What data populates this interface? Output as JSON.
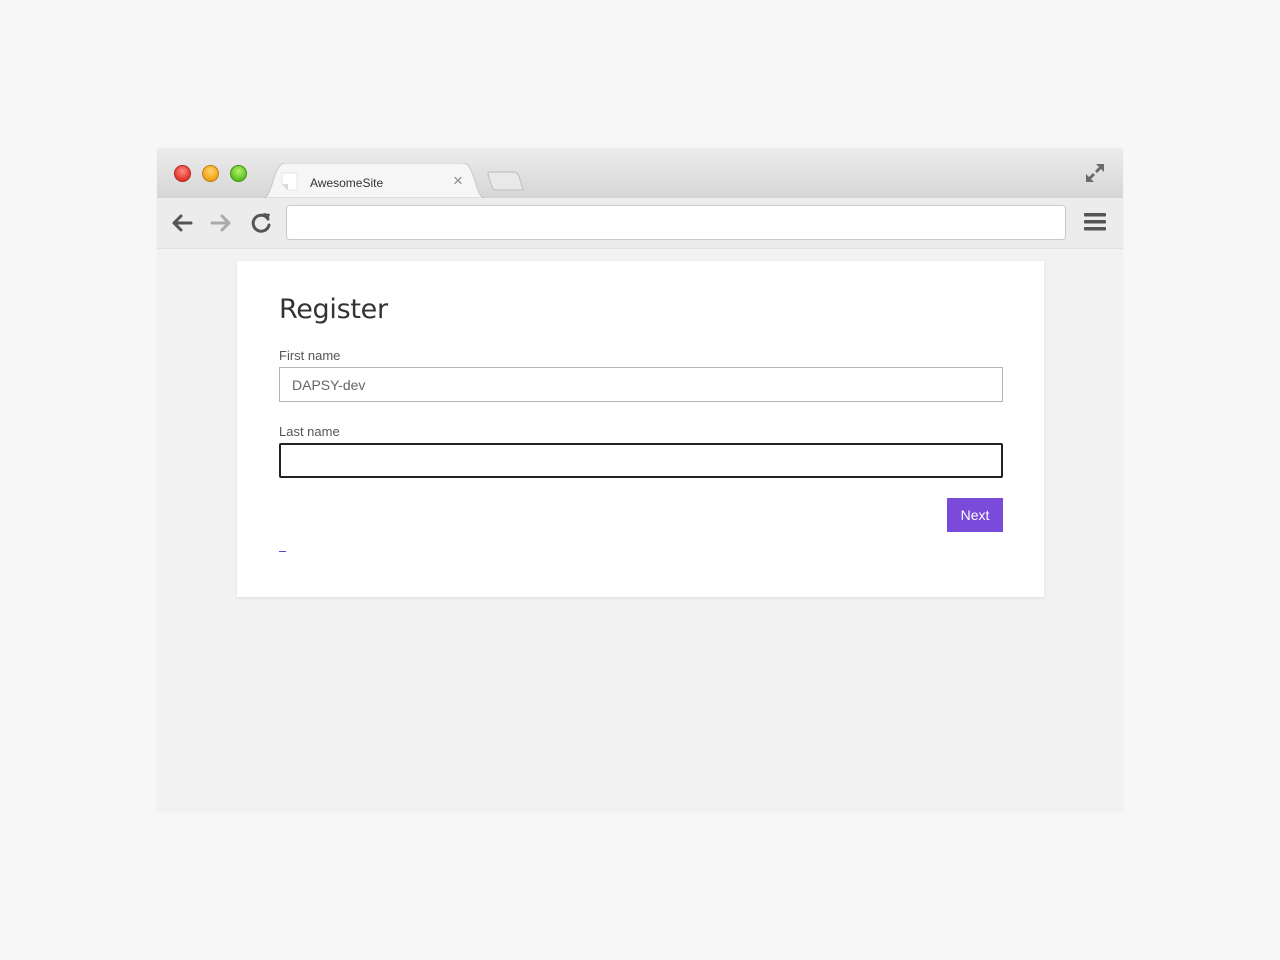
{
  "browser": {
    "tab_title": "AwesomeSite",
    "tab_close": "×",
    "address": ""
  },
  "icons": {
    "back": "back-arrow-icon",
    "forward": "forward-arrow-icon",
    "reload": "reload-icon",
    "menu": "hamburger-menu-icon",
    "expand": "fullscreen-expand-icon",
    "favicon": "page-favicon-icon"
  },
  "form": {
    "title": "Register",
    "first_name_label": "First name",
    "first_name_value": "DAPSY-dev",
    "last_name_label": "Last name",
    "last_name_value": "",
    "next_label": "Next"
  },
  "colors": {
    "accent": "#7a4bdb",
    "link": "#5a3fd6"
  }
}
